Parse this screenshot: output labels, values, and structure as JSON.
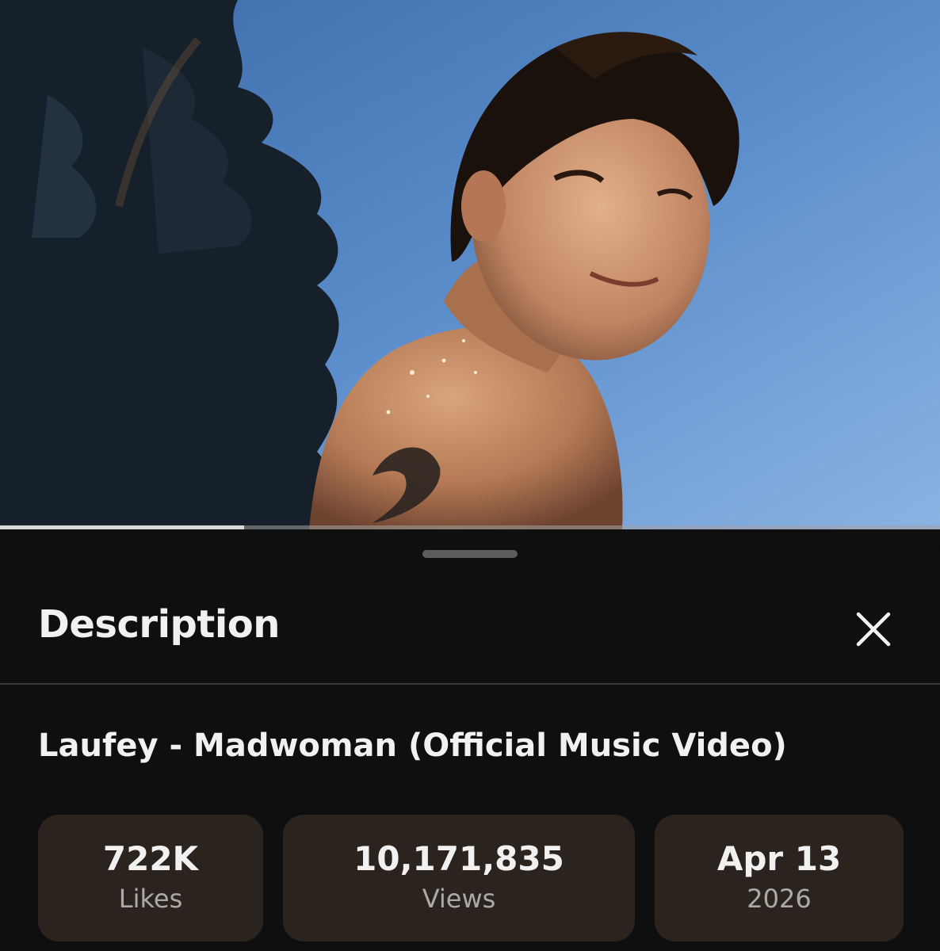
{
  "player": {
    "progress_fraction": 0.26,
    "video_art_icon": "video-frame-image"
  },
  "description_sheet": {
    "title": "Description",
    "close_icon": "close-icon",
    "video_title": "Laufey - Madwoman (Official Music Video)",
    "stats": [
      {
        "value": "722K",
        "label": "Likes"
      },
      {
        "value": "10,171,835",
        "label": "Views"
      },
      {
        "value": "Apr 13",
        "label": "2026"
      }
    ]
  },
  "colors": {
    "background": "#0f0f0f",
    "stat_card": "#2b241e",
    "primary_text": "#f1f1f1",
    "secondary_text": "#aaaaaa",
    "progress_fill": "#d8d8d8"
  }
}
